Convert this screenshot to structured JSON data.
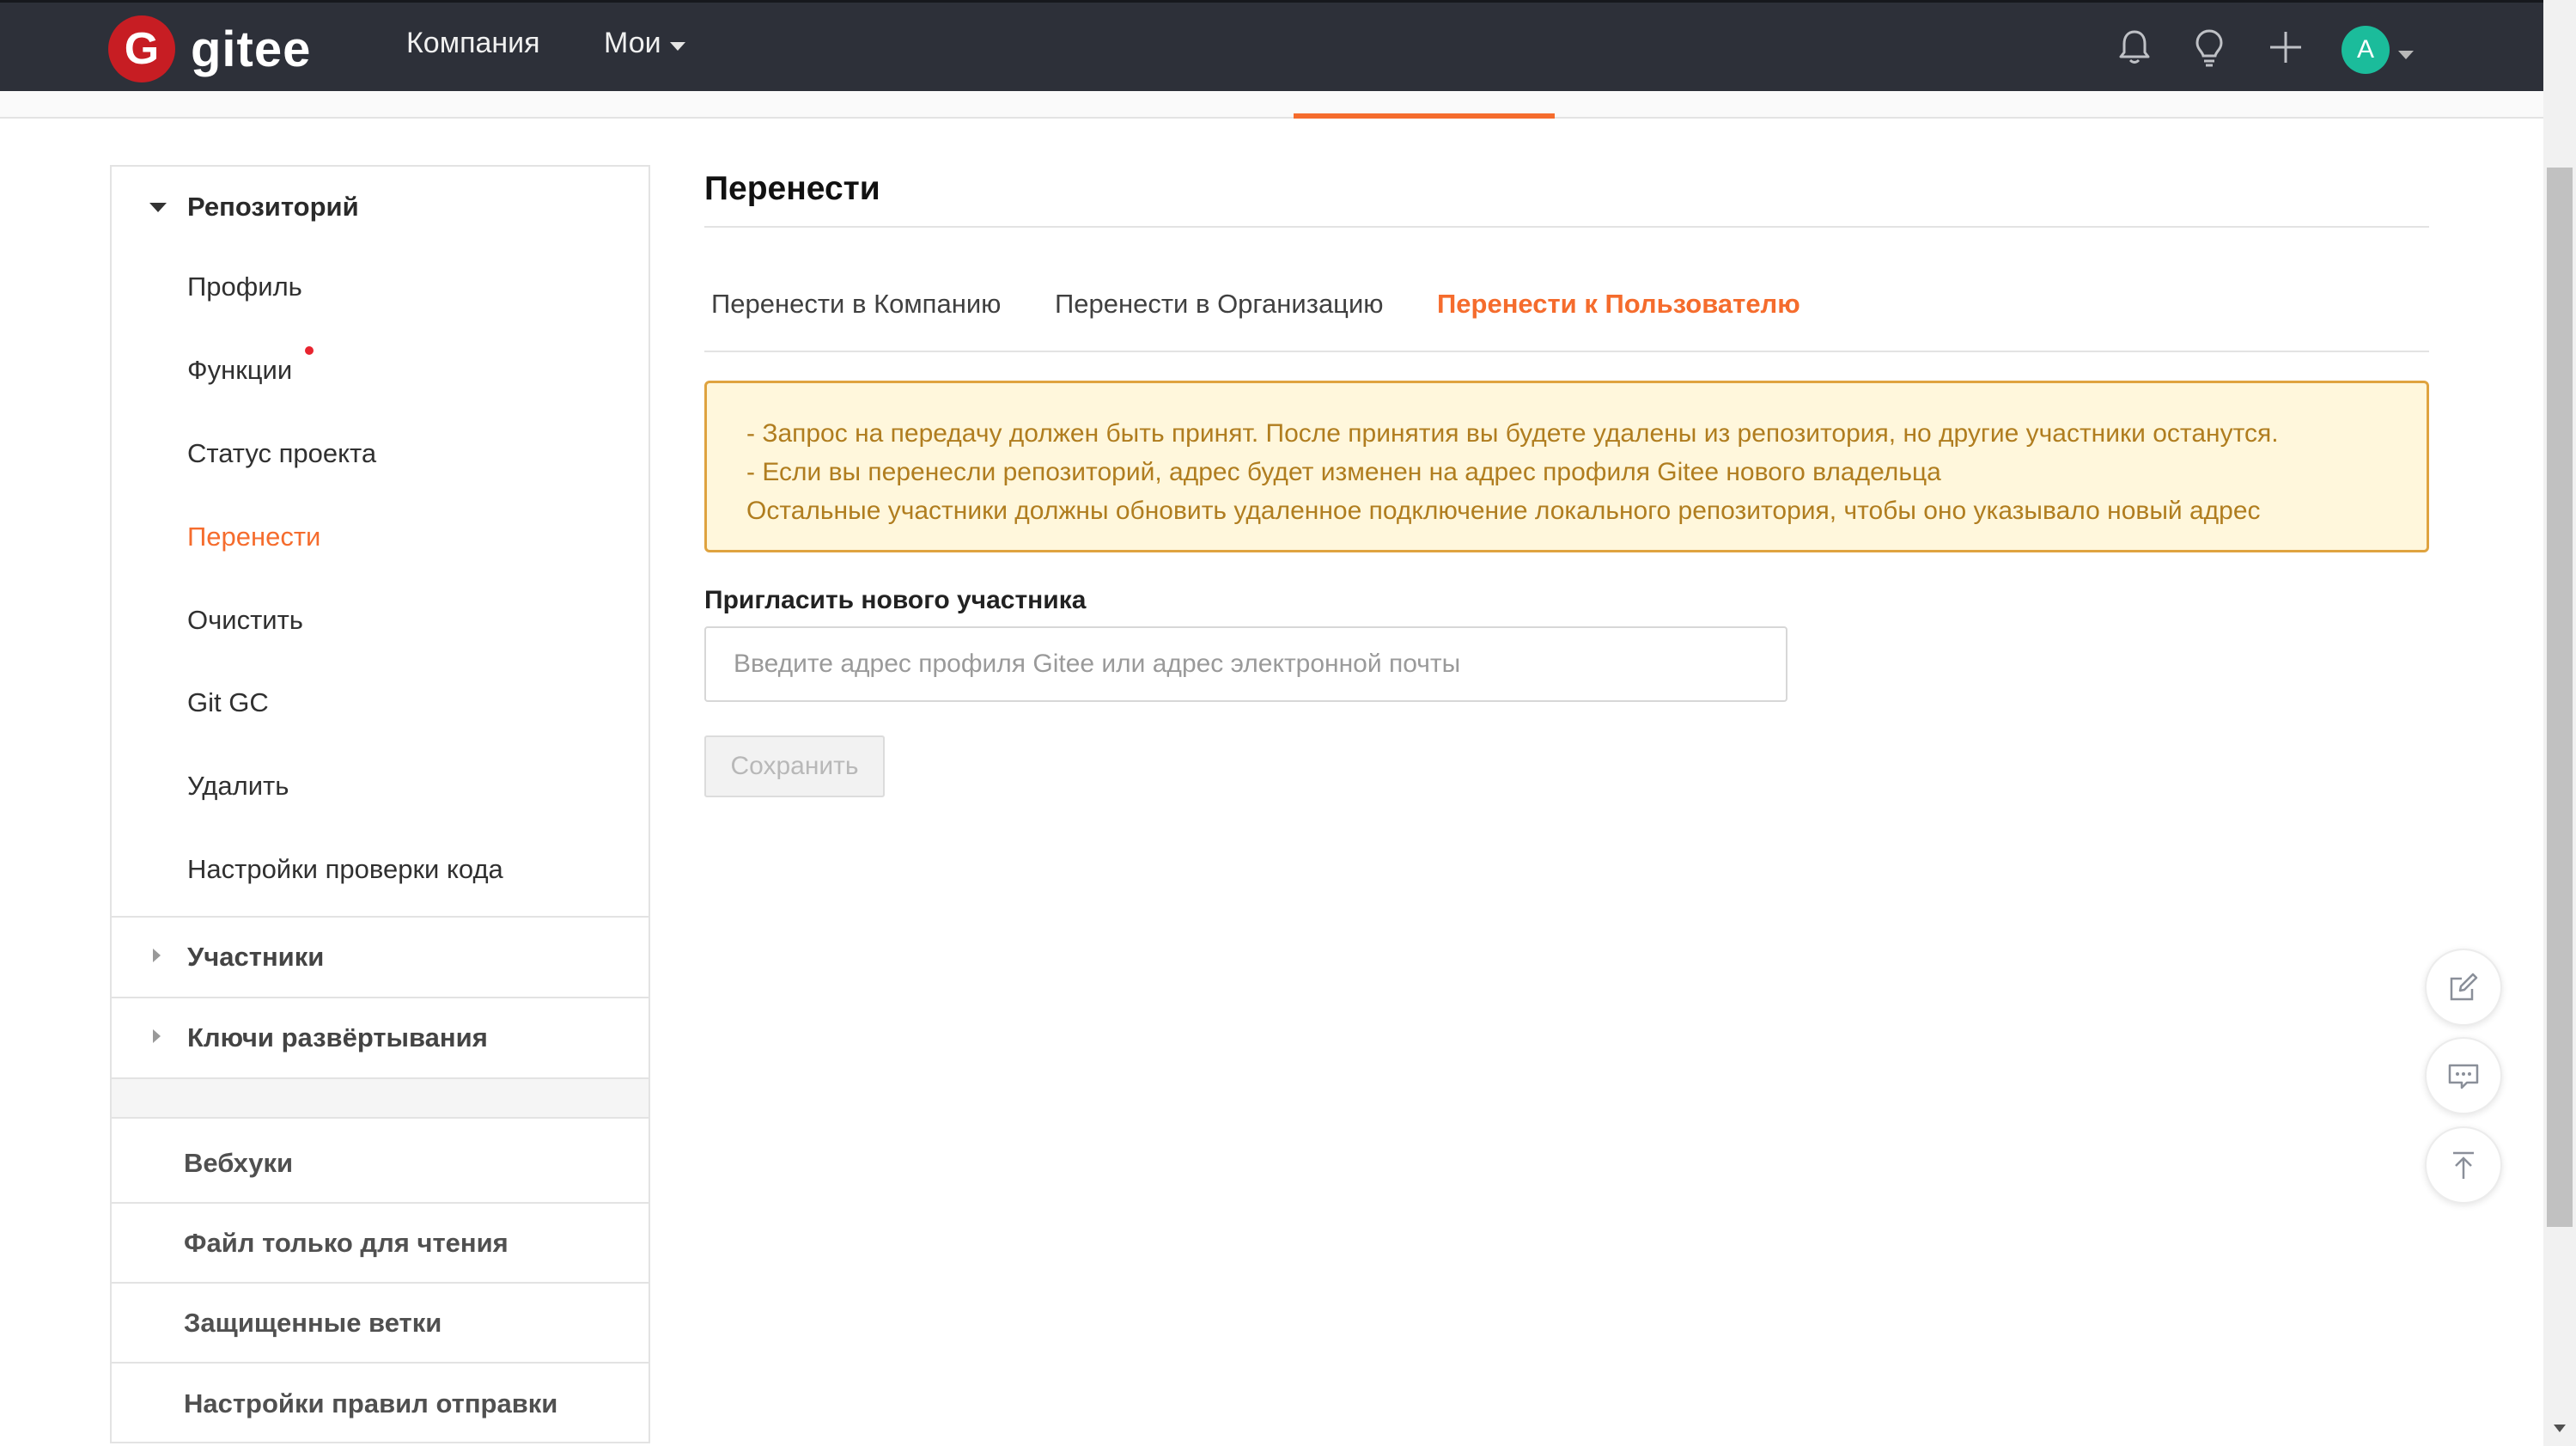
{
  "app": {
    "name": "gitee",
    "logo_letter": "G"
  },
  "topnav": {
    "company": "Компания",
    "mine": "Мои",
    "avatar_letter": "A",
    "icons": [
      "bell-icon",
      "lightbulb-icon",
      "plus-icon"
    ]
  },
  "sidebar": {
    "repo_section": "Репозиторий",
    "items": [
      {
        "label": "Профиль"
      },
      {
        "label": "Функции"
      },
      {
        "label": "Статус проекта"
      },
      {
        "label": "Перенести"
      },
      {
        "label": "Очистить"
      },
      {
        "label": "Git GC"
      },
      {
        "label": "Удалить"
      },
      {
        "label": "Настройки проверки кода"
      }
    ],
    "members_section": "Участники",
    "deploy_keys_section": "Ключи развёртывания",
    "links": [
      {
        "label": "Вебхуки"
      },
      {
        "label": "Файл только для чтения"
      },
      {
        "label": "Защищенные ветки"
      },
      {
        "label": "Настройки правил отправки"
      }
    ]
  },
  "main": {
    "title": "Перенести",
    "tabs": [
      {
        "label": "Перенести в Компанию"
      },
      {
        "label": "Перенести в Организацию"
      },
      {
        "label": "Перенести к Пользователю"
      }
    ],
    "active_tab": "Перенести к Пользователю",
    "notice": [
      "- Запрос на передачу должен быть принят. После принятия вы будете удалены из репозитория, но другие участники останутся.",
      "- Если вы перенесли репозиторий, адрес будет изменен на адрес профиля Gitee нового владельца",
      "Остальные участники должны обновить удаленное подключение локального репозитория, чтобы оно указывало новый адрес"
    ],
    "invite_label": "Пригласить нового участника",
    "invite_placeholder": "Введите адрес профиля Gitee или адрес электронной почты",
    "invite_value": "",
    "save_label": "Сохранить"
  },
  "floating": [
    "edit-icon",
    "chat-icon",
    "back-to-top-icon"
  ],
  "colors": {
    "topbar": "#2d3039",
    "accent": "#f56c2d",
    "logo_red": "#c71d23",
    "avatar": "#1bbc9b",
    "notice_bg": "#fff7dc",
    "notice_border": "#dfa33f",
    "notice_text": "#b07d1f"
  }
}
